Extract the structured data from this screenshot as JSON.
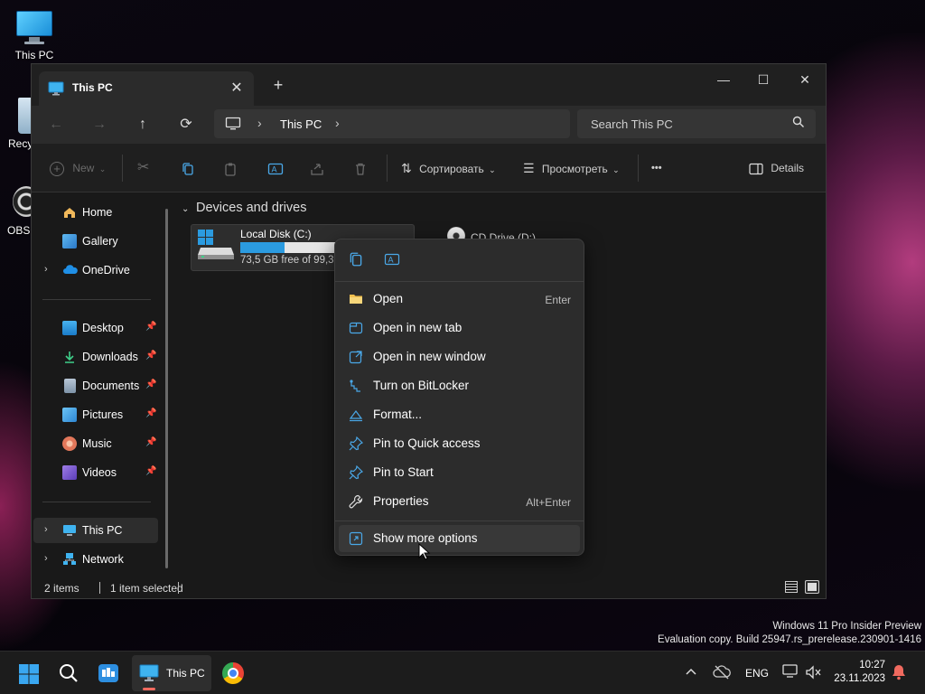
{
  "desktop": {
    "icons": [
      {
        "label": "This PC"
      },
      {
        "label": "Recy"
      },
      {
        "label": "OBS"
      }
    ]
  },
  "window": {
    "tab_title": "This PC",
    "tab_close": "✕",
    "new_tab": "+",
    "controls": {
      "minimize": "—",
      "maximize": "☐",
      "close": "✕"
    }
  },
  "navbar": {
    "back": "←",
    "forward": "→",
    "up": "↑",
    "refresh": "⟳",
    "breadcrumb_sep": "›",
    "breadcrumb": [
      "This PC"
    ],
    "search_placeholder": "Search This PC"
  },
  "toolbar": {
    "new_label": "New",
    "sort_label": "Сортировать",
    "view_label": "Просмотреть",
    "more_label": "•••",
    "details_label": "Details"
  },
  "sidebar": {
    "items": [
      {
        "label": "Home",
        "pinned": false,
        "chevron": false
      },
      {
        "label": "Gallery",
        "pinned": false,
        "chevron": false
      },
      {
        "label": "OneDrive",
        "pinned": false,
        "chevron": true
      },
      {
        "label": "Desktop",
        "pinned": true,
        "chevron": false
      },
      {
        "label": "Downloads",
        "pinned": true,
        "chevron": false
      },
      {
        "label": "Documents",
        "pinned": true,
        "chevron": false
      },
      {
        "label": "Pictures",
        "pinned": true,
        "chevron": false
      },
      {
        "label": "Music",
        "pinned": true,
        "chevron": false
      },
      {
        "label": "Videos",
        "pinned": true,
        "chevron": false
      },
      {
        "label": "This PC",
        "pinned": false,
        "chevron": true,
        "selected": true
      },
      {
        "label": "Network",
        "pinned": false,
        "chevron": true
      }
    ],
    "pin_glyph": "📌",
    "chevron_glyph": "›"
  },
  "content": {
    "section_title": "Devices and drives",
    "drives": [
      {
        "name": "Local Disk (C:)",
        "free_text": "73,5 GB free of 99,3",
        "used_fraction": 0.26
      },
      {
        "name": "CD Drive (D:)"
      }
    ]
  },
  "statusbar": {
    "items_count": "2 items",
    "selected": "1 item selected"
  },
  "context_menu": {
    "items": [
      {
        "label": "Open",
        "shortcut": "Enter",
        "icon": "folder-icon"
      },
      {
        "label": "Open in new tab",
        "shortcut": "",
        "icon": "new-tab-icon"
      },
      {
        "label": "Open in new window",
        "shortcut": "",
        "icon": "new-window-icon"
      },
      {
        "label": "Turn on BitLocker",
        "shortcut": "",
        "icon": "key-icon"
      },
      {
        "label": "Format...",
        "shortcut": "",
        "icon": "format-icon"
      },
      {
        "label": "Pin to Quick access",
        "shortcut": "",
        "icon": "pin-icon"
      },
      {
        "label": "Pin to Start",
        "shortcut": "",
        "icon": "pin-icon"
      },
      {
        "label": "Properties",
        "shortcut": "Alt+Enter",
        "icon": "wrench-icon"
      }
    ],
    "more_options": "Show more options"
  },
  "taskbar": {
    "active_app_label": "This PC",
    "language": "ENG",
    "time": "10:27",
    "date": "23.11.2023"
  },
  "watermark": {
    "line1": "Windows 11 Pro Insider Preview",
    "line2": "Evaluation copy. Build 25947.rs_prerelease.230901-1416"
  },
  "colors": {
    "accent": "#2b9be0",
    "window_bg": "#191919",
    "menu_bg": "#2c2c2c"
  }
}
